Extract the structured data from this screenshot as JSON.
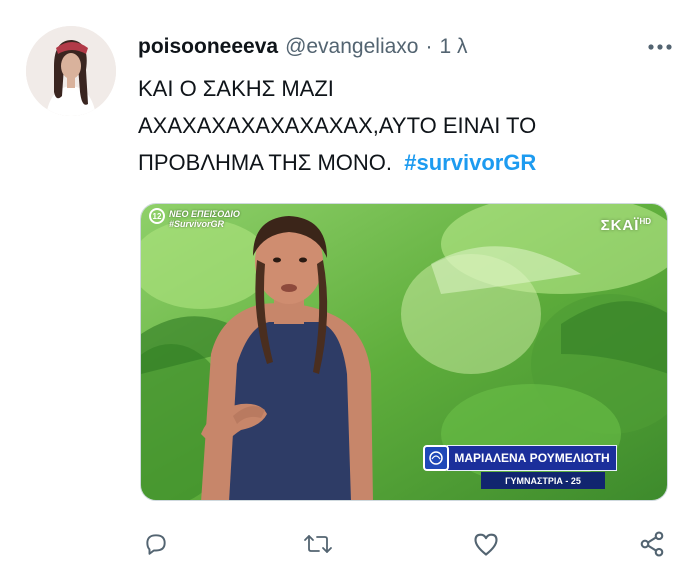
{
  "tweet": {
    "author": {
      "display_name": "poisooneeeva",
      "handle": "@evangeliaxo",
      "avatar": "profile-photo"
    },
    "separator": "·",
    "time": "1 λ",
    "more_icon": "more-horizontal-icon",
    "text_lines": [
      "ΚΑΙ Ο ΣΑΚΗΣ ΜΑΖΙ",
      "ΑΧΑΧΑΧΑΧΑΧΑΧΑΧΑΧ,ΑΥΤΟ ΕΙΝΑΙ ΤΟ",
      "ΠΡΟΒΛΗΜΑ ΤΗΣ ΜΟΝΟ."
    ],
    "hashtag": "#survivorGR",
    "media": {
      "episode_badge": "12",
      "episode_label_1": "ΝΕΟ ΕΠΕΙΣΟΔΙΟ",
      "episode_label_2": "#SurvivorGR",
      "channel": "ΣΚΑΪ",
      "channel_hd": "HD",
      "lower_third_name": "ΜΑΡΙΑΛΕΝΑ ΡΟΥΜΕΛΙΩΤΗ",
      "lower_third_role": "ΓΥΜΝΑΣΤΡΙΑ - 25"
    },
    "actions": [
      "reply-icon",
      "retweet-icon",
      "like-icon",
      "share-icon"
    ]
  },
  "colors": {
    "text": "#0f1419",
    "secondary": "#536471",
    "hashtag": "#1d9bf0",
    "icon": "#536471",
    "lower_third": "#1b2f9b"
  }
}
